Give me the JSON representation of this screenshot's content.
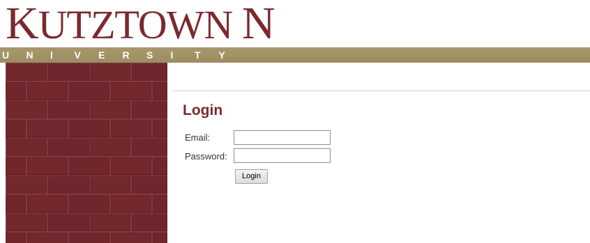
{
  "logo": {
    "first_letter": "K",
    "rest": "UTZTOWN",
    "last_letter": "N",
    "alt": "Kutztown University logo"
  },
  "banner": {
    "letters": [
      "U",
      "N",
      "I",
      "V",
      "E",
      "R",
      "S",
      "I",
      "T",
      "Y"
    ]
  },
  "login": {
    "title": "Login",
    "email_label": "Email:",
    "password_label": "Password:",
    "email_value": "",
    "password_value": "",
    "button_label": "Login"
  },
  "colors": {
    "brand_maroon": "#7a2a2f",
    "banner_gold": "#a8986d",
    "brick": "#6e2328"
  }
}
